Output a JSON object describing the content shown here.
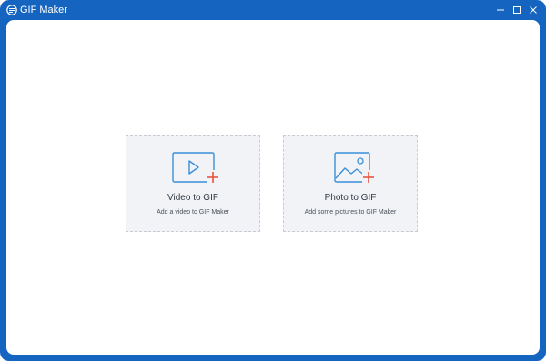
{
  "window": {
    "title": "GIF Maker",
    "accent_color": "#1565c0",
    "icons": {
      "app": "gif-maker-app-icon",
      "minimize": "minimize-icon",
      "maximize": "maximize-icon",
      "close": "close-icon"
    }
  },
  "cards": [
    {
      "title": "Video to GIF",
      "subtitle": "Add a video to GIF Maker",
      "icon": "video-add-icon"
    },
    {
      "title": "Photo to GIF",
      "subtitle": "Add some pictures to GIF Maker",
      "icon": "photo-add-icon"
    }
  ],
  "colors": {
    "icon_outline": "#3a8fd8",
    "plus_accent": "#e8553d",
    "card_bg": "#f1f3f6"
  }
}
